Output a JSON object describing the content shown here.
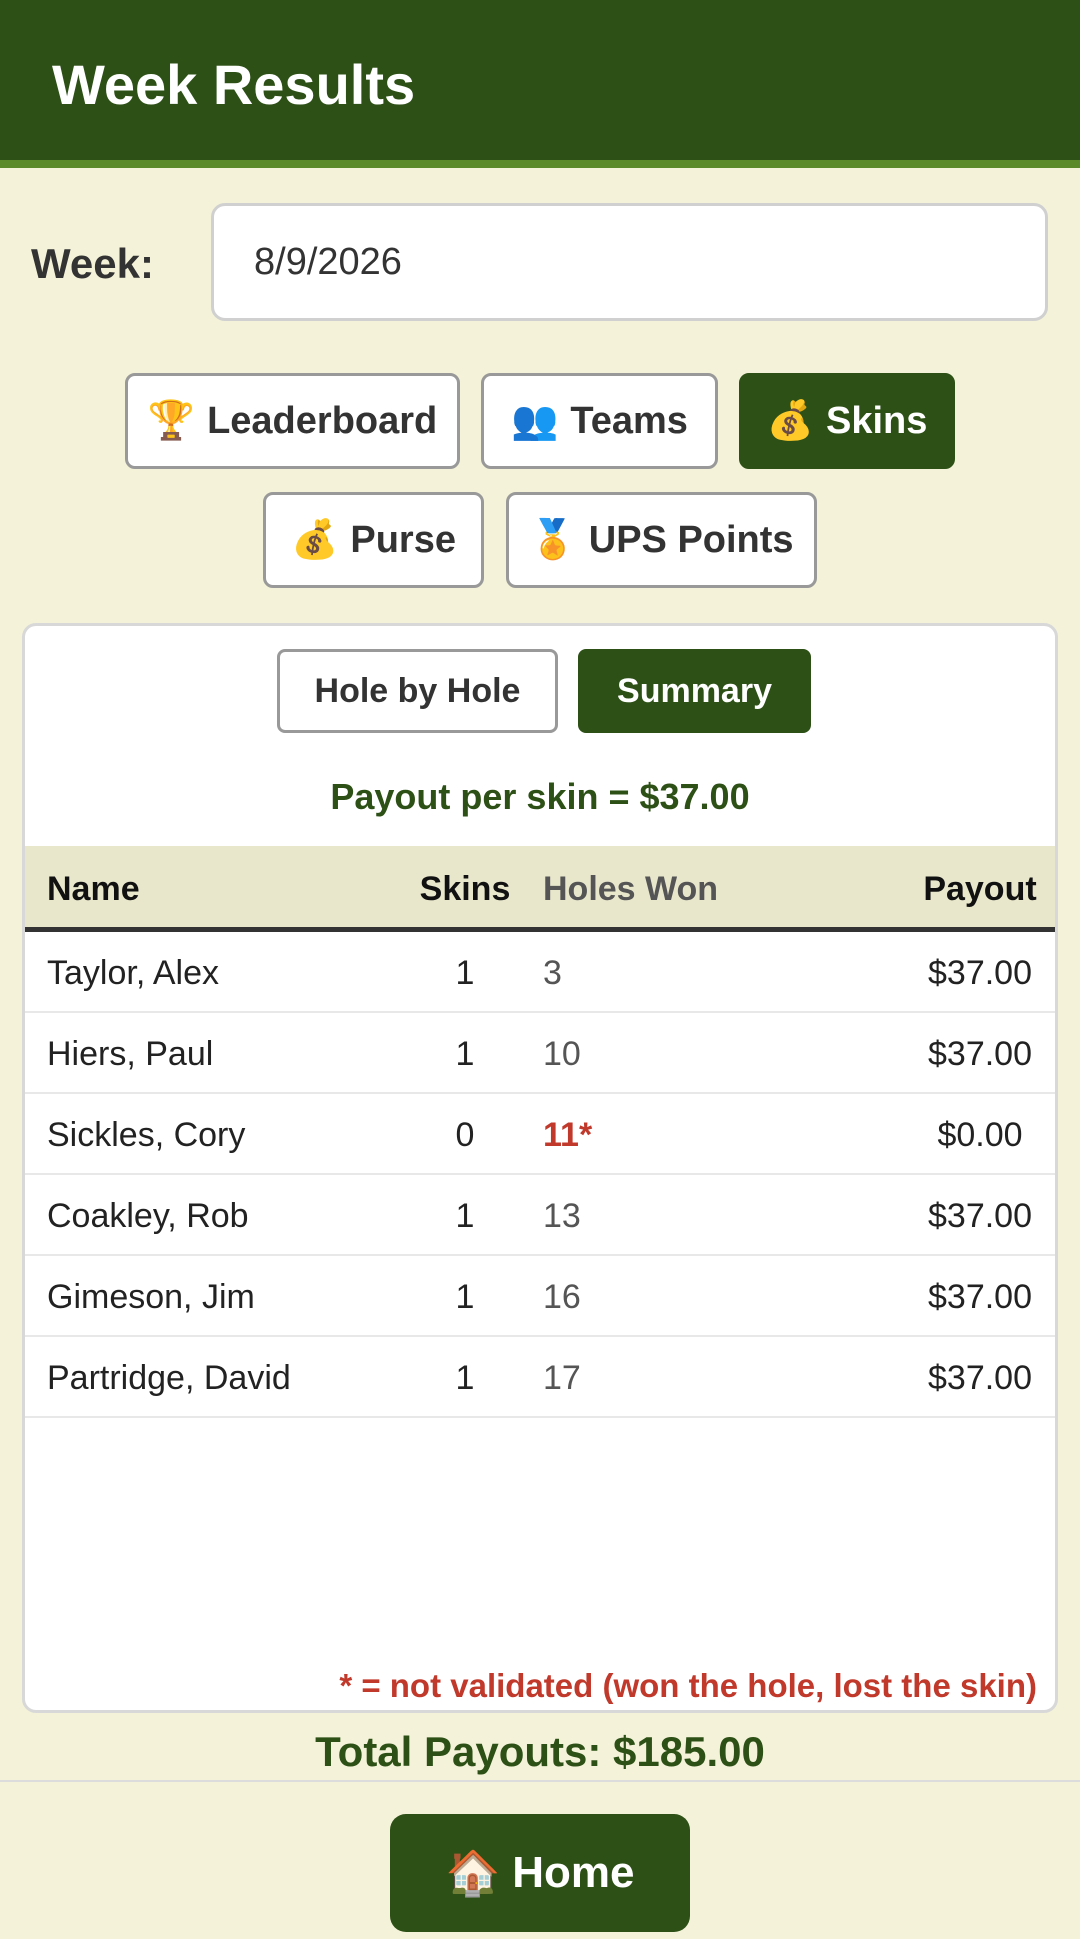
{
  "header": {
    "title": "Week Results"
  },
  "week": {
    "label": "Week:",
    "value": "8/9/2026"
  },
  "tabs": [
    {
      "icon": "🏆",
      "label": "Leaderboard",
      "active": false
    },
    {
      "icon": "👥",
      "label": "Teams",
      "active": false
    },
    {
      "icon": "💰",
      "label": "Skins",
      "active": true
    },
    {
      "icon": "💰",
      "label": "Purse",
      "active": false
    },
    {
      "icon": "🏅",
      "label": "UPS Points",
      "active": false
    }
  ],
  "subtabs": [
    {
      "label": "Hole by Hole",
      "active": false
    },
    {
      "label": "Summary",
      "active": true
    }
  ],
  "payout_per_skin": "Payout per skin = $37.00",
  "table": {
    "headers": {
      "name": "Name",
      "skins": "Skins",
      "holes": "Holes Won",
      "payout": "Payout"
    },
    "rows": [
      {
        "name": "Taylor, Alex",
        "skins": "1",
        "holes": "3",
        "payout": "$37.00",
        "validated": true
      },
      {
        "name": "Hiers, Paul",
        "skins": "1",
        "holes": "10",
        "payout": "$37.00",
        "validated": true
      },
      {
        "name": "Sickles, Cory",
        "skins": "0",
        "holes": "11*",
        "payout": "$0.00",
        "validated": false
      },
      {
        "name": "Coakley, Rob",
        "skins": "1",
        "holes": "13",
        "payout": "$37.00",
        "validated": true
      },
      {
        "name": "Gimeson, Jim",
        "skins": "1",
        "holes": "16",
        "payout": "$37.00",
        "validated": true
      },
      {
        "name": "Partridge, David",
        "skins": "1",
        "holes": "17",
        "payout": "$37.00",
        "validated": true
      }
    ]
  },
  "footnote": "* = not validated (won the hole, lost the skin)",
  "total_payouts": "Total Payouts: $185.00",
  "home": {
    "icon": "🏠",
    "label": "Home"
  },
  "colors": {
    "primary": "#2d5016",
    "background": "#f4f3d9",
    "warning": "#c0392b"
  }
}
